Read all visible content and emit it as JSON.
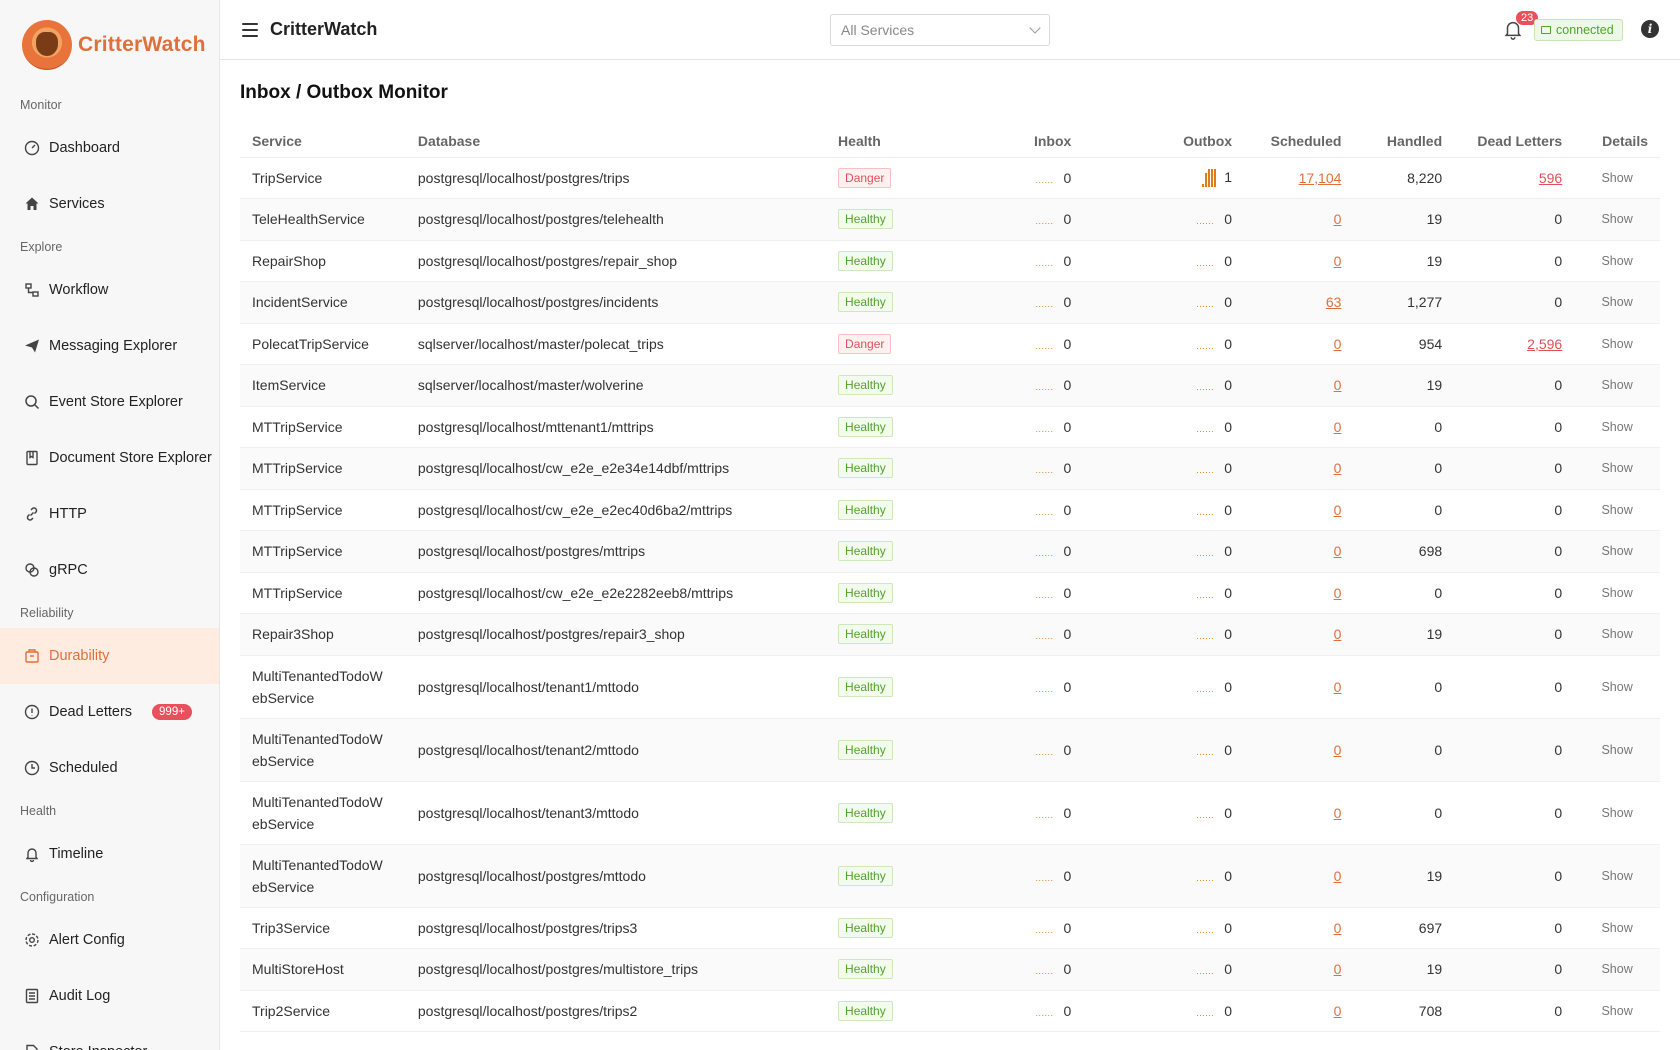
{
  "brand": {
    "name": "CritterWatch"
  },
  "sidebar": {
    "sections": [
      {
        "title": "Monitor",
        "items": [
          {
            "label": "Dashboard",
            "icon": "dashboard-icon"
          },
          {
            "label": "Services",
            "icon": "home-icon"
          }
        ]
      },
      {
        "title": "Explore",
        "items": [
          {
            "label": "Workflow",
            "icon": "workflow-icon"
          },
          {
            "label": "Messaging Explorer",
            "icon": "send-icon"
          },
          {
            "label": "Event Store Explorer",
            "icon": "search-icon"
          },
          {
            "label": "Document Store Explorer",
            "icon": "book-icon"
          },
          {
            "label": "HTTP",
            "icon": "link-icon"
          },
          {
            "label": "gRPC",
            "icon": "grpc-icon"
          }
        ]
      },
      {
        "title": "Reliability",
        "items": [
          {
            "label": "Durability",
            "icon": "box-icon",
            "active": true
          },
          {
            "label": "Dead Letters",
            "icon": "alert-circle-icon",
            "badge": "999+"
          },
          {
            "label": "Scheduled",
            "icon": "clock-icon"
          }
        ]
      },
      {
        "title": "Health",
        "items": [
          {
            "label": "Timeline",
            "icon": "bell-icon"
          }
        ]
      },
      {
        "title": "Configuration",
        "items": [
          {
            "label": "Alert Config",
            "icon": "gear-icon"
          },
          {
            "label": "Audit Log",
            "icon": "list-icon"
          },
          {
            "label": "Store Inspector",
            "icon": "document-icon"
          }
        ]
      }
    ]
  },
  "header": {
    "title": "CritterWatch",
    "service_select": {
      "value": "All Services"
    },
    "notifications_count": "23",
    "connection_status": "connected"
  },
  "main": {
    "title": "Inbox / Outbox Monitor",
    "columns": [
      "Service",
      "Database",
      "Health",
      "Inbox",
      "Outbox",
      "Scheduled",
      "Handled",
      "Dead Letters",
      "Details"
    ],
    "rows": [
      {
        "service": "TripService",
        "database": "postgresql/localhost/postgres/trips",
        "health": "Danger",
        "inbox": "0",
        "outbox": "1",
        "scheduled": "17,104",
        "handled": "8,220",
        "dead_letters": "596",
        "details": "Show"
      },
      {
        "service": "TeleHealthService",
        "database": "postgresql/localhost/postgres/telehealth",
        "health": "Healthy",
        "inbox": "0",
        "outbox": "0",
        "scheduled": "0",
        "handled": "19",
        "dead_letters": "0",
        "details": "Show"
      },
      {
        "service": "RepairShop",
        "database": "postgresql/localhost/postgres/repair_shop",
        "health": "Healthy",
        "inbox": "0",
        "outbox": "0",
        "scheduled": "0",
        "handled": "19",
        "dead_letters": "0",
        "details": "Show"
      },
      {
        "service": "IncidentService",
        "database": "postgresql/localhost/postgres/incidents",
        "health": "Healthy",
        "inbox": "0",
        "outbox": "0",
        "scheduled": "63",
        "handled": "1,277",
        "dead_letters": "0",
        "details": "Show"
      },
      {
        "service": "PolecatTripService",
        "database": "sqlserver/localhost/master/polecat_trips",
        "health": "Danger",
        "inbox": "0",
        "outbox": "0",
        "scheduled": "0",
        "handled": "954",
        "dead_letters": "2,596",
        "details": "Show"
      },
      {
        "service": "ItemService",
        "database": "sqlserver/localhost/master/wolverine",
        "health": "Healthy",
        "inbox": "0",
        "outbox": "0",
        "scheduled": "0",
        "handled": "19",
        "dead_letters": "0",
        "details": "Show"
      },
      {
        "service": "MTTripService",
        "database": "postgresql/localhost/mttenant1/mttrips",
        "health": "Healthy",
        "inbox": "0",
        "outbox": "0",
        "scheduled": "0",
        "handled": "0",
        "dead_letters": "0",
        "details": "Show"
      },
      {
        "service": "MTTripService",
        "database": "postgresql/localhost/cw_e2e_e2e34e14dbf/mttrips",
        "health": "Healthy",
        "inbox": "0",
        "outbox": "0",
        "scheduled": "0",
        "handled": "0",
        "dead_letters": "0",
        "details": "Show"
      },
      {
        "service": "MTTripService",
        "database": "postgresql/localhost/cw_e2e_e2ec40d6ba2/mttrips",
        "health": "Healthy",
        "inbox": "0",
        "outbox": "0",
        "scheduled": "0",
        "handled": "0",
        "dead_letters": "0",
        "details": "Show"
      },
      {
        "service": "MTTripService",
        "database": "postgresql/localhost/postgres/mttrips",
        "health": "Healthy",
        "inbox": "0",
        "outbox": "0",
        "scheduled": "0",
        "handled": "698",
        "dead_letters": "0",
        "details": "Show"
      },
      {
        "service": "MTTripService",
        "database": "postgresql/localhost/cw_e2e_e2e2282eeb8/mttrips",
        "health": "Healthy",
        "inbox": "0",
        "outbox": "0",
        "scheduled": "0",
        "handled": "0",
        "dead_letters": "0",
        "details": "Show"
      },
      {
        "service": "Repair3Shop",
        "database": "postgresql/localhost/postgres/repair3_shop",
        "health": "Healthy",
        "inbox": "0",
        "outbox": "0",
        "scheduled": "0",
        "handled": "19",
        "dead_letters": "0",
        "details": "Show"
      },
      {
        "service": "MultiTenantedTodoWebService",
        "service_lines": [
          "MultiTenantedTodoW",
          "ebService"
        ],
        "database": "postgresql/localhost/tenant1/mttodo",
        "health": "Healthy",
        "inbox": "0",
        "outbox": "0",
        "scheduled": "0",
        "handled": "0",
        "dead_letters": "0",
        "details": "Show"
      },
      {
        "service": "MultiTenantedTodoWebService",
        "service_lines": [
          "MultiTenantedTodoW",
          "ebService"
        ],
        "database": "postgresql/localhost/tenant2/mttodo",
        "health": "Healthy",
        "inbox": "0",
        "outbox": "0",
        "scheduled": "0",
        "handled": "0",
        "dead_letters": "0",
        "details": "Show"
      },
      {
        "service": "MultiTenantedTodoWebService",
        "service_lines": [
          "MultiTenantedTodoW",
          "ebService"
        ],
        "database": "postgresql/localhost/tenant3/mttodo",
        "health": "Healthy",
        "inbox": "0",
        "outbox": "0",
        "scheduled": "0",
        "handled": "0",
        "dead_letters": "0",
        "details": "Show"
      },
      {
        "service": "MultiTenantedTodoWebService",
        "service_lines": [
          "MultiTenantedTodoW",
          "ebService"
        ],
        "database": "postgresql/localhost/postgres/mttodo",
        "health": "Healthy",
        "inbox": "0",
        "outbox": "0",
        "scheduled": "0",
        "handled": "19",
        "dead_letters": "0",
        "details": "Show"
      },
      {
        "service": "Trip3Service",
        "database": "postgresql/localhost/postgres/trips3",
        "health": "Healthy",
        "inbox": "0",
        "outbox": "0",
        "scheduled": "0",
        "handled": "697",
        "dead_letters": "0",
        "details": "Show"
      },
      {
        "service": "MultiStoreHost",
        "database": "postgresql/localhost/postgres/multistore_trips",
        "health": "Healthy",
        "inbox": "0",
        "outbox": "0",
        "scheduled": "0",
        "handled": "19",
        "dead_letters": "0",
        "details": "Show"
      },
      {
        "service": "Trip2Service",
        "database": "postgresql/localhost/postgres/trips2",
        "health": "Healthy",
        "inbox": "0",
        "outbox": "0",
        "scheduled": "0",
        "handled": "708",
        "dead_letters": "0",
        "details": "Show"
      }
    ]
  },
  "colors": {
    "accent": "#e0703a",
    "danger": "#e0505b",
    "healthy": "#52a32a"
  }
}
